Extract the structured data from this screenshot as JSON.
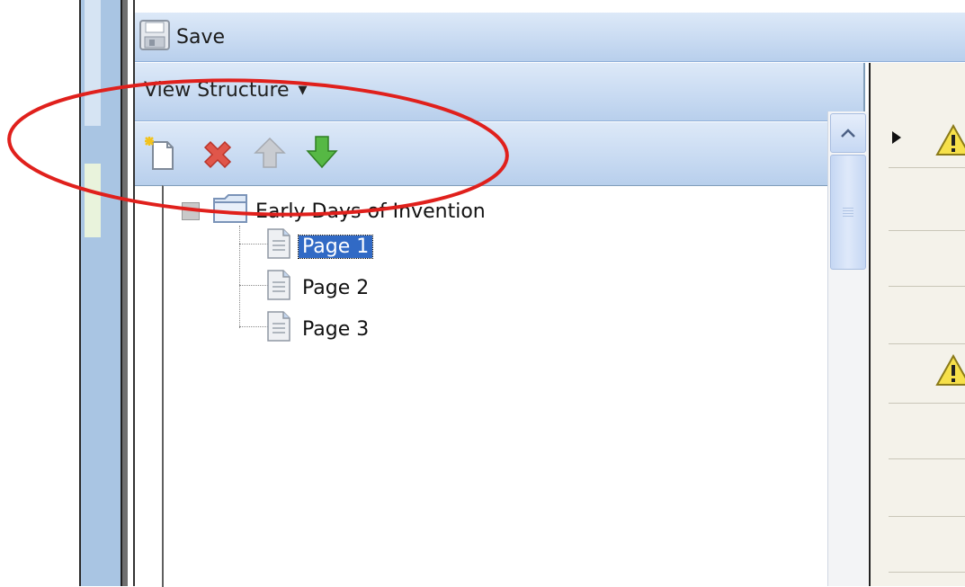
{
  "toolbar": {
    "save_label": "Save"
  },
  "view_menu": {
    "label": "View Structure"
  },
  "tree": {
    "root": {
      "label": "Early Days of Invention",
      "expanded": true
    },
    "pages": [
      {
        "label": "Page 1",
        "selected": true
      },
      {
        "label": "Page 2",
        "selected": false
      },
      {
        "label": "Page 3",
        "selected": false
      }
    ]
  },
  "icons": {
    "new_page": "new-page-icon",
    "delete": "delete-x-icon",
    "move_up": "arrow-up-icon",
    "move_down": "arrow-down-icon",
    "warning": "warning-icon"
  },
  "colors": {
    "accent_bar": "#c9dbf2",
    "selection": "#316ac5",
    "annotation": "#e0201c",
    "delete_red": "#e0564a",
    "down_green": "#4cae3a"
  }
}
